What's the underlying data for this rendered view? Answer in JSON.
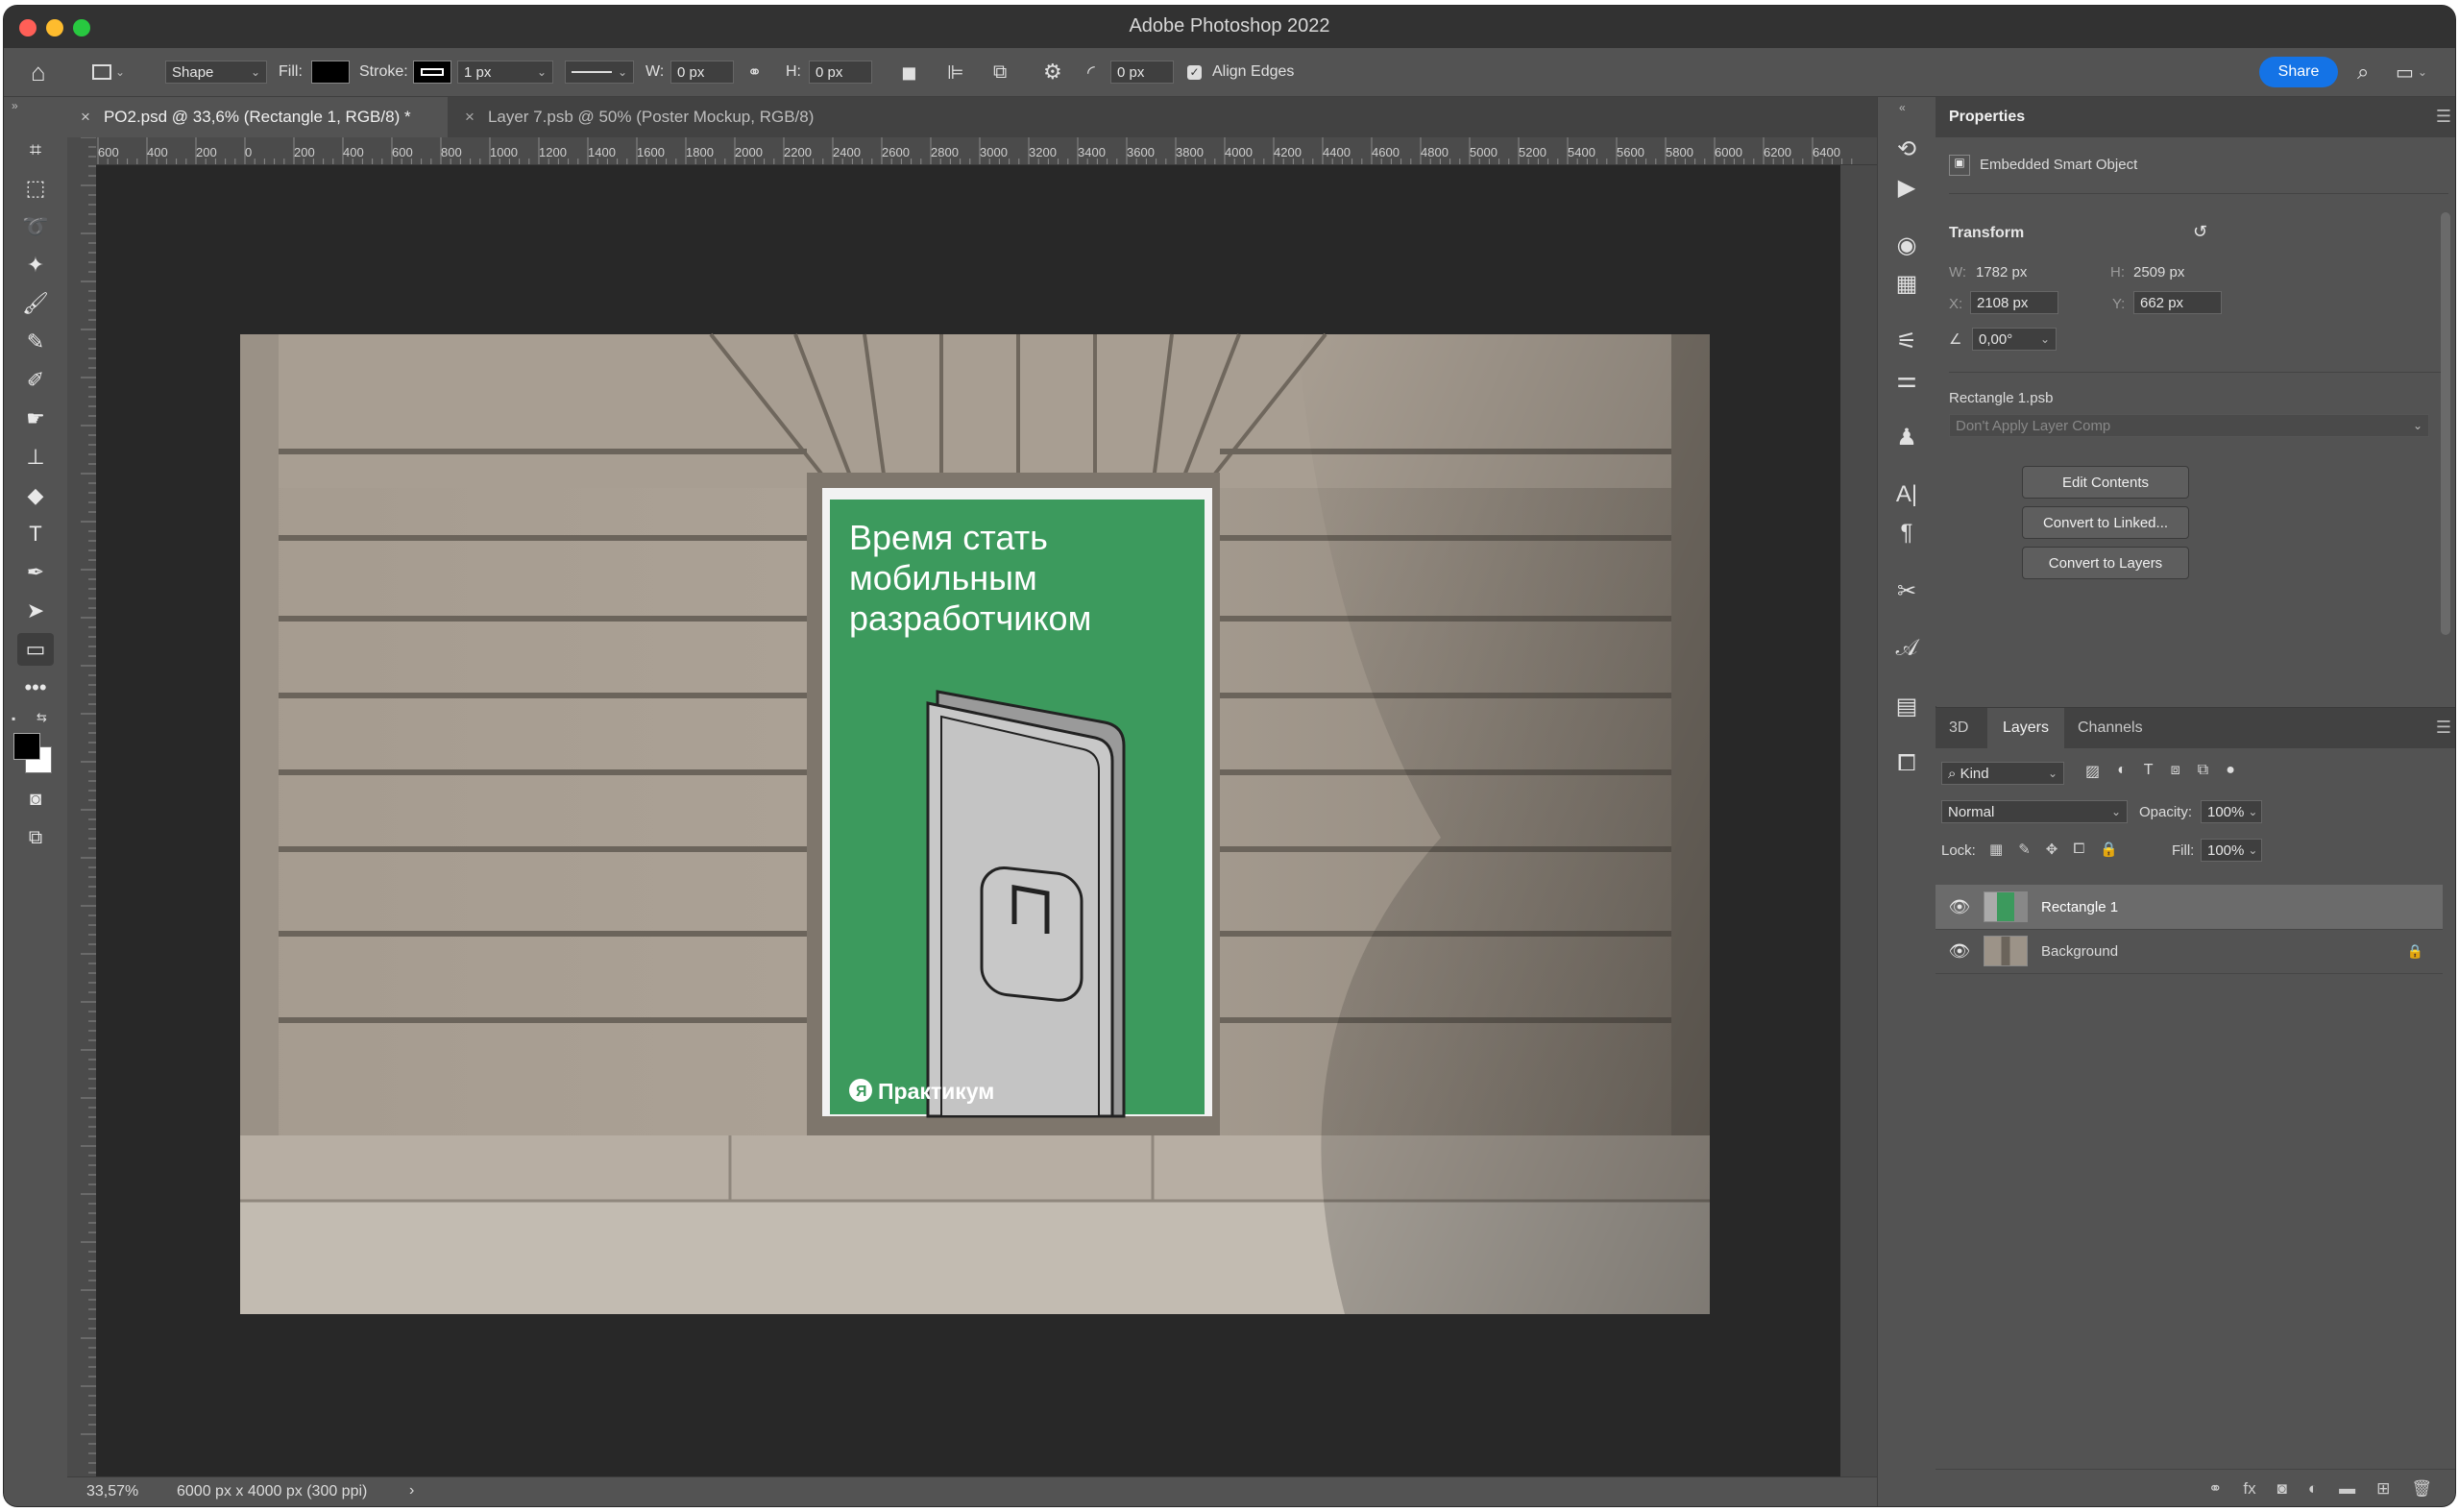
{
  "app": {
    "title": "Adobe Photoshop 2022"
  },
  "options": {
    "mode": "Shape",
    "fill_label": "Fill:",
    "stroke_label": "Stroke:",
    "stroke_width": "1 px",
    "w_label": "W:",
    "w_value": "0 px",
    "h_label": "H:",
    "h_value": "0 px",
    "radius_value": "0 px",
    "align_edges": "Align Edges",
    "share": "Share"
  },
  "tabs": [
    {
      "label": "PO2.psd @ 33,6% (Rectangle 1, RGB/8) *",
      "active": true
    },
    {
      "label": "Layer 7.psb @ 50% (Poster Mockup, RGB/8)",
      "active": false
    }
  ],
  "ruler": [
    "600",
    "400",
    "200",
    "0",
    "200",
    "400",
    "600",
    "800",
    "1000",
    "1200",
    "1400",
    "1600",
    "1800",
    "2000",
    "2200",
    "2400",
    "2600",
    "2800",
    "3000",
    "3200",
    "3400",
    "3600",
    "3800",
    "4000",
    "4200",
    "4400",
    "4600",
    "4800",
    "5000",
    "5200",
    "5400",
    "5600",
    "5800",
    "6000",
    "6200",
    "6400"
  ],
  "poster": {
    "headline": [
      "Время стать",
      "мобильным",
      "разработчиком"
    ],
    "brand_letter": "Я",
    "brand": "Практикум"
  },
  "status": {
    "zoom": "33,57%",
    "doc": "6000 px x 4000 px (300 ppi)",
    "arrow": "›"
  },
  "properties": {
    "tab": "Properties",
    "type": "Embedded Smart Object",
    "transform": "Transform",
    "w_label": "W:",
    "w_value": "1782 px",
    "h_label": "H:",
    "h_value": "2509 px",
    "x_label": "X:",
    "x_value": "2108 px",
    "y_label": "Y:",
    "y_value": "662 px",
    "angle": "0,00°",
    "file": "Rectangle 1.psb",
    "comp": "Don't Apply Layer Comp",
    "buttons": [
      "Edit Contents",
      "Convert to Linked...",
      "Convert to Layers"
    ]
  },
  "layers_panel": {
    "tabs": [
      "3D",
      "Layers",
      "Channels"
    ],
    "kind": "Kind",
    "blend": "Normal",
    "opacity_label": "Opacity:",
    "opacity": "100%",
    "lock_label": "Lock:",
    "fill_label": "Fill:",
    "fill": "100%",
    "layers": [
      {
        "name": "Rectangle 1",
        "selected": true
      },
      {
        "name": "Background",
        "selected": false
      }
    ]
  },
  "colors": {
    "poster_green": "#3c9a5d",
    "share_blue": "#1473e6"
  }
}
